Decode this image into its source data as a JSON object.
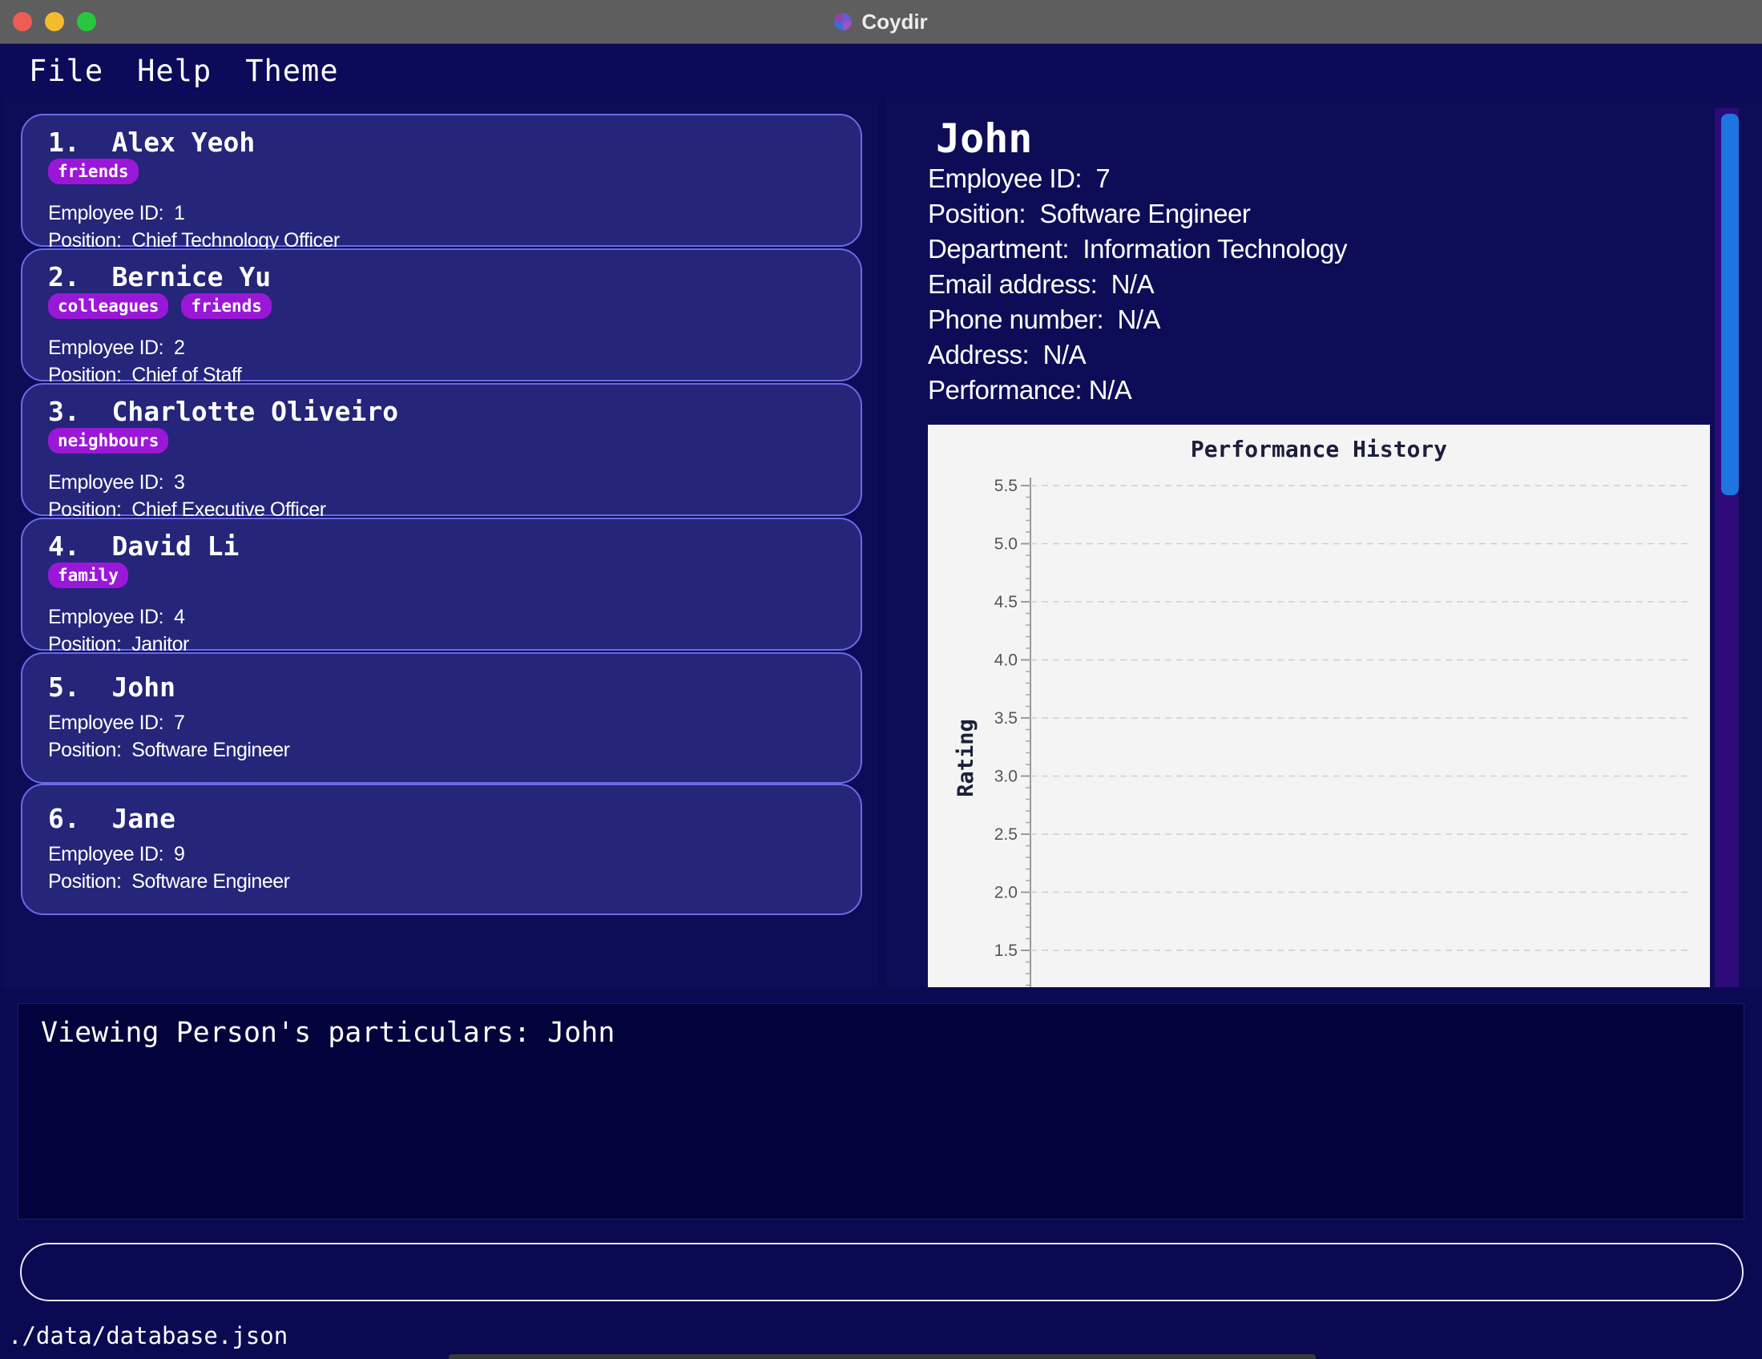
{
  "window": {
    "title": "Coydir"
  },
  "menu": [
    {
      "label": "File"
    },
    {
      "label": "Help"
    },
    {
      "label": "Theme"
    }
  ],
  "persons": [
    {
      "name": "1.  Alex Yeoh",
      "tags": [
        "friends"
      ],
      "employee_id": "Employee ID:  1",
      "position": "Position:  Chief Technology Officer"
    },
    {
      "name": "2.  Bernice Yu",
      "tags": [
        "colleagues",
        "friends"
      ],
      "employee_id": "Employee ID:  2",
      "position": "Position:  Chief of Staff"
    },
    {
      "name": "3.  Charlotte Oliveiro",
      "tags": [
        "neighbours"
      ],
      "employee_id": "Employee ID:  3",
      "position": "Position:  Chief Executive Officer"
    },
    {
      "name": "4.  David Li",
      "tags": [
        "family"
      ],
      "employee_id": "Employee ID:  4",
      "position": "Position:  Janitor"
    },
    {
      "name": "5.  John",
      "tags": [],
      "employee_id": "Employee ID:  7",
      "position": "Position:  Software Engineer"
    },
    {
      "name": "6.  Jane",
      "tags": [],
      "employee_id": "Employee ID:  9",
      "position": "Position:  Software Engineer"
    }
  ],
  "detail": {
    "name": "John",
    "employee_id": "Employee ID:  7",
    "position": "Position:  Software Engineer",
    "department": "Department:  Information Technology",
    "email": "Email address:  N/A",
    "phone": "Phone number:  N/A",
    "address": "Address:  N/A",
    "performance": "Performance: N/A"
  },
  "chart_data": {
    "type": "line",
    "title": "Performance History",
    "xlabel": "",
    "ylabel": "Rating",
    "y_ticks": [
      "5.5",
      "5.0",
      "4.5",
      "4.0",
      "3.5",
      "3.0",
      "2.5",
      "2.0",
      "1.5"
    ],
    "ylim": [
      1.5,
      5.5
    ],
    "series": [],
    "grid": true
  },
  "result_display": {
    "text": "Viewing Person's particulars: John"
  },
  "command_box": {
    "value": "",
    "placeholder": ""
  },
  "status_bar": {
    "path": "./data/database.json"
  }
}
